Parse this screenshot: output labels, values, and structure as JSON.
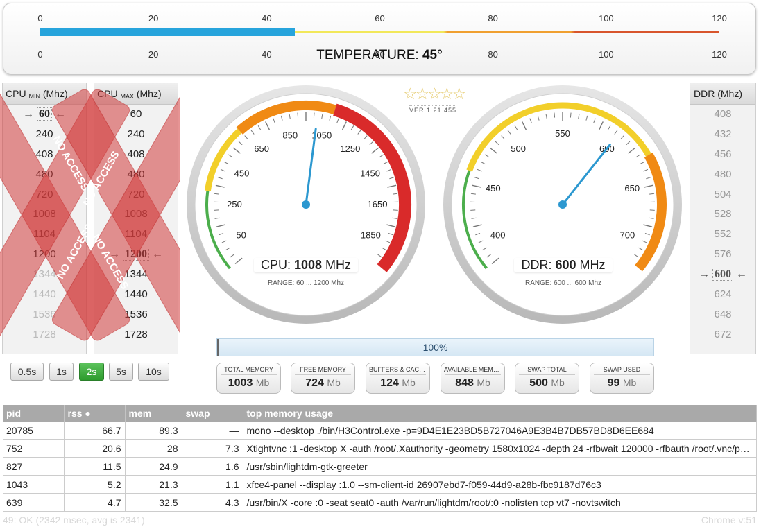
{
  "temperature": {
    "ticks": [
      "0",
      "20",
      "40",
      "60",
      "80",
      "100",
      "120"
    ],
    "label": "TEMPERATURE:",
    "value": "45°",
    "current": 45,
    "max": 120,
    "colors": {
      "fill": "#27a4dc",
      "low": "#f2e85a",
      "mid": "#f0a030",
      "high": "#d8552c"
    }
  },
  "cpu_min": {
    "header": "CPU",
    "header_sub": "MIN",
    "header_unit": "(Mhz)",
    "items": [
      "240",
      "408",
      "480",
      "720",
      "1008",
      "1104",
      "1200",
      "1344",
      "1440",
      "1536",
      "1728"
    ],
    "selected": "60",
    "overlay_text": "NO ACCESS"
  },
  "cpu_max": {
    "header": "CPU",
    "header_sub": "MAX",
    "header_unit": "(Mhz)",
    "items": [
      "60",
      "240",
      "408",
      "480",
      "720",
      "1008",
      "1104"
    ],
    "selected": "1200",
    "items_after": [
      "1344",
      "1440",
      "1536",
      "1728"
    ],
    "overlay_text": "NO ACCESS"
  },
  "ddr": {
    "header": "DDR (Mhz)",
    "items_before": [
      "408",
      "432",
      "456",
      "480",
      "504",
      "528",
      "552",
      "576"
    ],
    "selected": "600",
    "items_after": [
      "624",
      "648",
      "672"
    ]
  },
  "rating": {
    "stars": "☆☆☆☆☆",
    "version": "VER 1.21.455"
  },
  "cpu_gauge": {
    "labels": [
      "50",
      "250",
      "450",
      "650",
      "850",
      "1050",
      "1250",
      "1450",
      "1650",
      "1850"
    ],
    "label": "CPU:",
    "value": "1008",
    "unit": "MHz",
    "current": 1008,
    "range": "RANGE: 60 ... 1200 Mhz"
  },
  "ddr_gauge": {
    "labels": [
      "400",
      "450",
      "500",
      "550",
      "600",
      "650",
      "700"
    ],
    "label": "DDR:",
    "value": "600",
    "unit": "MHz",
    "current": 600,
    "range": "RANGE: 600 ... 600 Mhz"
  },
  "intervals": {
    "items": [
      "0.5s",
      "1s",
      "2s",
      "5s",
      "10s"
    ],
    "active": "2s"
  },
  "progress": {
    "text": "100%",
    "value": 100
  },
  "memory": [
    {
      "label": "TOTAL MEMORY",
      "value": "1003",
      "unit": "Mb"
    },
    {
      "label": "FREE MEMORY",
      "value": "724",
      "unit": "Mb"
    },
    {
      "label": "BUFFERS & CACHE",
      "value": "124",
      "unit": "Mb"
    },
    {
      "label": "AVAILABLE MEMORY",
      "value": "848",
      "unit": "Mb"
    },
    {
      "label": "SWAP TOTAL",
      "value": "500",
      "unit": "Mb"
    },
    {
      "label": "SWAP USED",
      "value": "99",
      "unit": "Mb"
    }
  ],
  "table": {
    "headers": [
      "pid",
      "rss ●",
      "mem",
      "swap",
      "top memory usage"
    ],
    "rows": [
      [
        "20785",
        "66.7",
        "89.3",
        "—",
        "mono --desktop ./bin/H3Control.exe -p=9D4E1E23BD5B727046A9E3B4B7DB57BD8D6EE684"
      ],
      [
        "752",
        "20.6",
        "28",
        "7.3",
        "Xtightvnc :1 -desktop X -auth /root/.Xauthority -geometry 1580x1024 -depth 24 -rfbwait 120000 -rfbauth /root/.vnc/passwd"
      ],
      [
        "827",
        "11.5",
        "24.9",
        "1.6",
        "/usr/sbin/lightdm-gtk-greeter"
      ],
      [
        "1043",
        "5.2",
        "21.3",
        "1.1",
        "xfce4-panel --display :1.0 --sm-client-id 26907ebd7-f059-44d9-a28b-fbc9187d76c3"
      ],
      [
        "639",
        "4.7",
        "32.5",
        "4.3",
        "/usr/bin/X -core :0 -seat seat0 -auth /var/run/lightdm/root/:0 -nolisten tcp vt7 -novtswitch"
      ]
    ]
  },
  "status": {
    "left": "49: OK (2342 msec, avg is 2341)",
    "right": "Chrome v:51"
  }
}
